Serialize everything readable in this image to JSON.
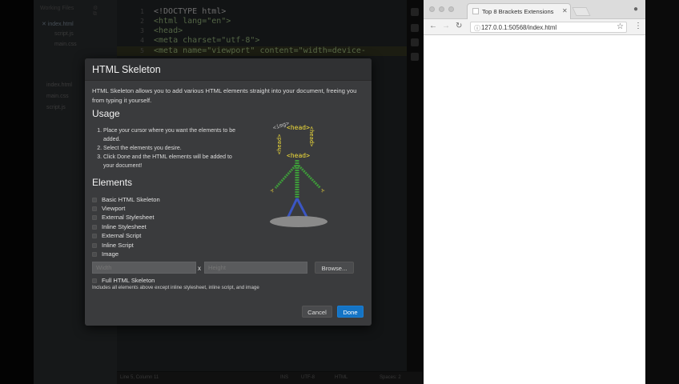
{
  "editor": {
    "working_files_label": "Working Files",
    "working_files": [
      {
        "name": "index.html",
        "ext": "",
        "active": true
      },
      {
        "name": "script.js",
        "ext": "",
        "active": false
      },
      {
        "name": "main.css",
        "ext": "",
        "active": false
      }
    ],
    "project_files": [
      {
        "name": "index.html"
      },
      {
        "name": "main.css"
      },
      {
        "name": "script.js"
      }
    ],
    "code_lines": [
      {
        "num": "1",
        "text": "<!DOCTYPE html>"
      },
      {
        "num": "2",
        "text": "<html lang=\"en\">"
      },
      {
        "num": "3",
        "text": "<head>"
      },
      {
        "num": "4",
        "text": "    <meta charset=\"utf-8\">"
      },
      {
        "num": "5",
        "text": "    <meta name=\"viewport\" content=\"width=device-"
      }
    ],
    "status": {
      "cursor": "Line 5, Column 11",
      "ins": "INS",
      "encoding": "UTF-8",
      "language": "HTML",
      "spaces": "Spaces: 2"
    }
  },
  "dialog": {
    "title": "HTML Skeleton",
    "intro": "HTML Skeleton allows you to add various HTML elements straight into your document, freeing you from typing it yourself.",
    "usage_title": "Usage",
    "usage_steps": [
      "Place your cursor where you want the elements to be added.",
      "Select the elements you desire.",
      "Click Done and the HTML elements will be added to your document!"
    ],
    "elements_title": "Elements",
    "elements": [
      "Basic HTML Skeleton",
      "Viewport",
      "External Stylesheet",
      "Inline Stylesheet",
      "External Script",
      "Inline Script",
      "Image"
    ],
    "width_placeholder": "Width",
    "height_placeholder": "Height",
    "x_separator": "x",
    "browse_label": "Browse...",
    "full_label": "Full HTML Skeleton",
    "full_note": "Includes all elements above except inline stylesheet, inline script, and image",
    "cancel_label": "Cancel",
    "done_label": "Done",
    "illustration": {
      "img_tag": "<img>",
      "head_tag": "<head>"
    }
  },
  "browser": {
    "tab_title": "Top 8 Brackets Extensions",
    "url": "127.0.0.1:50568/index.html"
  }
}
